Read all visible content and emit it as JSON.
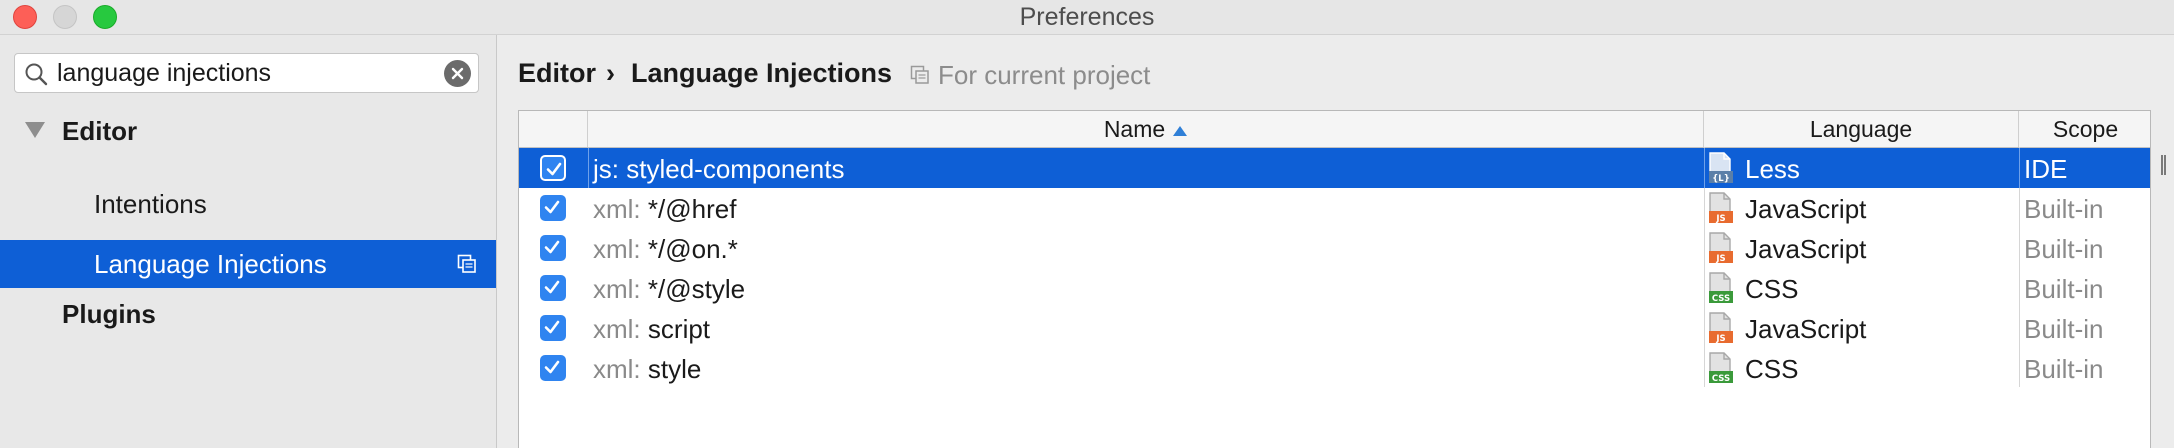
{
  "window": {
    "title": "Preferences"
  },
  "sidebar": {
    "search": {
      "value": "language injections",
      "placeholder": ""
    },
    "tree": [
      {
        "label": "Editor"
      },
      {
        "label": "Intentions"
      },
      {
        "label": "Language Injections"
      },
      {
        "label": "Plugins"
      }
    ]
  },
  "main": {
    "breadcrumb": {
      "parent": "Editor",
      "separator": "›",
      "current": "Language Injections",
      "scope_note": "For current project"
    },
    "table": {
      "columns": {
        "name": "Name",
        "language": "Language",
        "scope": "Scope"
      },
      "sort": {
        "column": "Name",
        "direction": "ascending"
      },
      "rows": [
        {
          "checked": true,
          "prefix": "js:",
          "name": "styled-components",
          "language": "Less",
          "lang_icon": "less-file-icon",
          "scope": "IDE",
          "selected": true
        },
        {
          "checked": true,
          "prefix": "xml:",
          "name": "*/@href",
          "language": "JavaScript",
          "lang_icon": "javascript-file-icon",
          "scope": "Built-in",
          "selected": false
        },
        {
          "checked": true,
          "prefix": "xml:",
          "name": "*/@on.*",
          "language": "JavaScript",
          "lang_icon": "javascript-file-icon",
          "scope": "Built-in",
          "selected": false
        },
        {
          "checked": true,
          "prefix": "xml:",
          "name": "*/@style",
          "language": "CSS",
          "lang_icon": "css-file-icon",
          "scope": "Built-in",
          "selected": false
        },
        {
          "checked": true,
          "prefix": "xml:",
          "name": "script",
          "language": "JavaScript",
          "lang_icon": "javascript-file-icon",
          "scope": "Built-in",
          "selected": false
        },
        {
          "checked": true,
          "prefix": "xml:",
          "name": "style",
          "language": "CSS",
          "lang_icon": "css-file-icon",
          "scope": "Built-in",
          "selected": false
        }
      ]
    }
  },
  "colors": {
    "selection": "#0e5fd6",
    "checkbox": "#2f84f0",
    "js_icon": "#e86b2f",
    "css_icon": "#3a9a3a",
    "less_icon": "#5b7fa8"
  }
}
